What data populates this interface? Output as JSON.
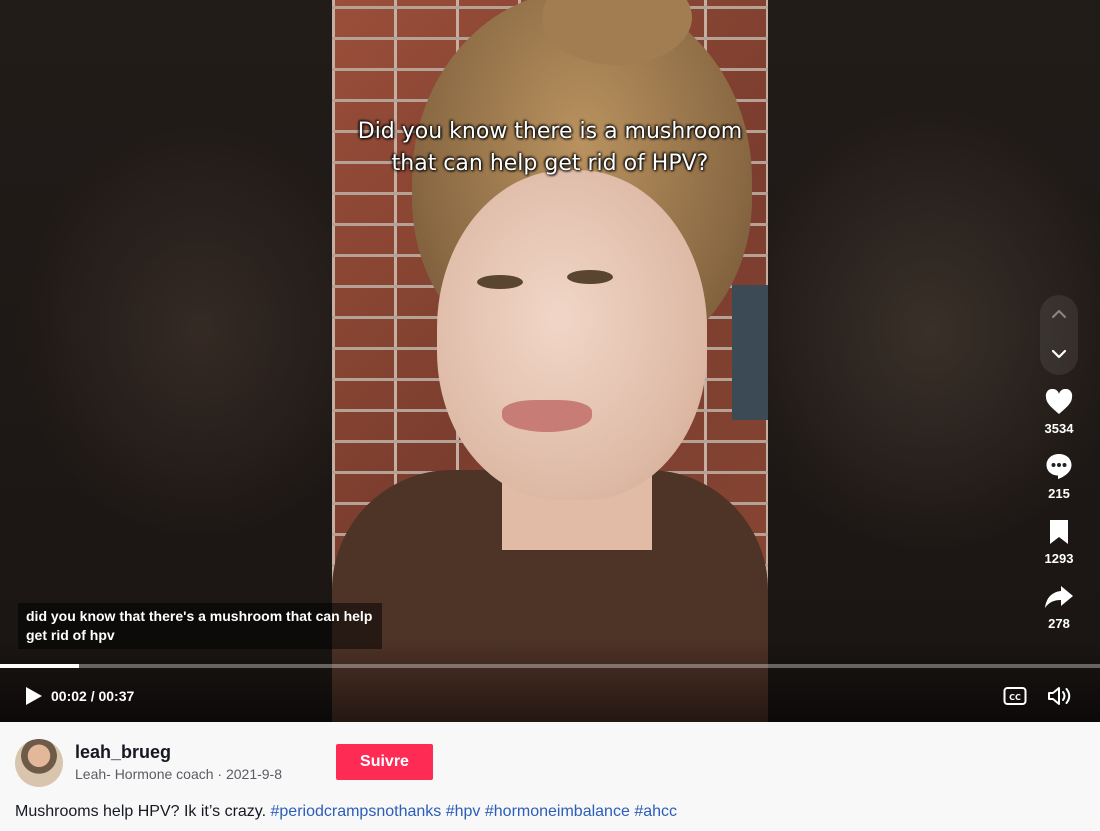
{
  "video": {
    "overlay_text": "Did you know there is a mushroom that can help get rid of HPV?",
    "subtitle": "did you know that there's a mushroom that can help get rid of hpv",
    "time": "00:02 / 00:37",
    "progress": 0.072
  },
  "actions": {
    "likes": "3534",
    "comments": "215",
    "saves": "1293",
    "shares": "278"
  },
  "author": {
    "username": "leah_brueg",
    "subtitle": "Leah- Hormone coach · 2021-9-8",
    "follow_label": "Suivre"
  },
  "description": {
    "text": "Mushrooms help HPV? Ik it’s crazy.",
    "hashtags": [
      "#periodcrampsnothanks",
      "#hpv",
      "#hormoneimbalance",
      "#ahcc"
    ]
  },
  "colors": {
    "follow_button": "#fe2c55",
    "hashtag": "#2b5db9"
  },
  "icons": [
    "heart-icon",
    "comment-icon",
    "bookmark-icon",
    "share-icon",
    "play-icon",
    "captions-icon",
    "volume-icon",
    "chevron-up-icon",
    "chevron-down-icon"
  ]
}
